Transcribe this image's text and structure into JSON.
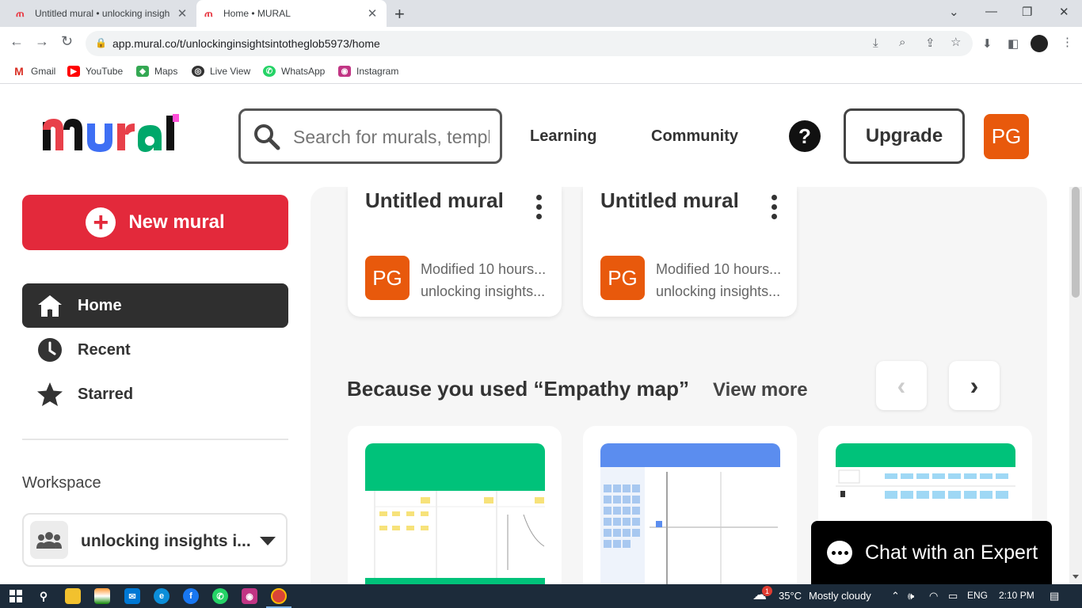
{
  "browser": {
    "tabs": [
      {
        "title": "Untitled mural • unlocking insigh",
        "favicon": "mural-favicon",
        "active": false
      },
      {
        "title": "Home • MURAL",
        "favicon": "mural-favicon",
        "active": true
      }
    ],
    "url": "app.mural.co/t/unlockinginsightsintotheglob5973/home",
    "bookmarks": [
      "Gmail",
      "YouTube",
      "Maps",
      "Live View",
      "WhatsApp",
      "Instagram"
    ]
  },
  "header": {
    "search_placeholder": "Search for murals, templates",
    "nav": [
      "Learning",
      "Community"
    ],
    "help_label": "?",
    "upgrade_label": "Upgrade",
    "avatar_initials": "PG"
  },
  "sidebar": {
    "new_mural_label": "New mural",
    "items": [
      {
        "label": "Home",
        "icon": "home-icon",
        "active": true
      },
      {
        "label": "Recent",
        "icon": "clock-icon",
        "active": false
      },
      {
        "label": "Starred",
        "icon": "star-icon",
        "active": false
      }
    ],
    "workspace_label": "Workspace",
    "workspace_name": "unlocking insights i..."
  },
  "murals": [
    {
      "title": "Untitled mural",
      "initials": "PG",
      "modified": "Modified 10 hours...",
      "workspace": "unlocking insights..."
    },
    {
      "title": "Untitled mural",
      "initials": "PG",
      "modified": "Modified 10 hours...",
      "workspace": "unlocking insights..."
    }
  ],
  "section": {
    "title": "Because you used  “Empathy map”",
    "view_more": "View more"
  },
  "chat": {
    "label": "Chat with an Expert"
  },
  "taskbar": {
    "weather_temp": "35°C",
    "weather_desc": "Mostly cloudy",
    "language": "ENG",
    "time": "2:10 PM",
    "notification_count": "1"
  },
  "colors": {
    "brand_red": "#e3293b",
    "avatar_orange": "#e8590c",
    "template1": "#00c27a",
    "template2": "#5b8def",
    "template3": "#00c27a"
  }
}
